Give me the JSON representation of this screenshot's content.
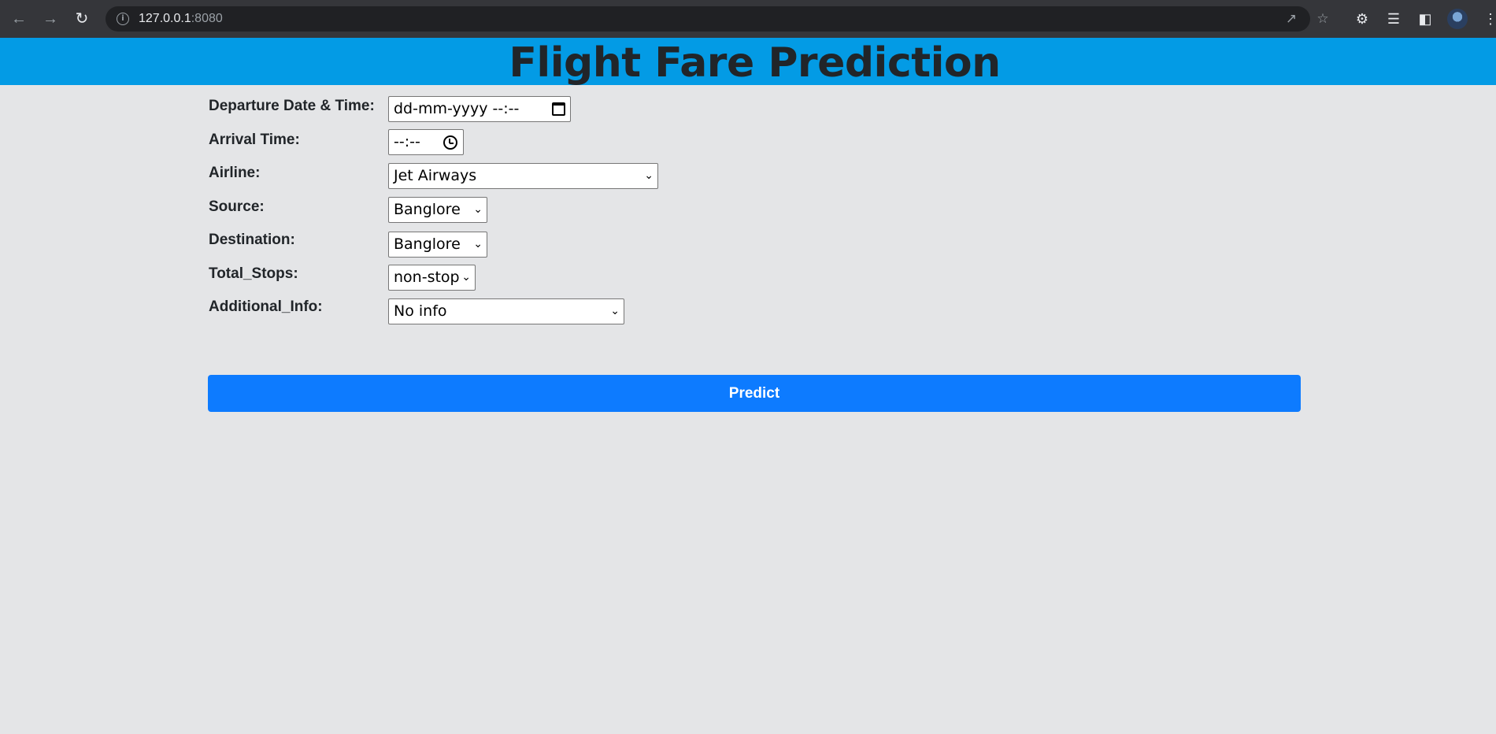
{
  "browser": {
    "url_host": "127.0.0.1",
    "url_port": ":8080"
  },
  "page": {
    "title": "Flight Fare Prediction"
  },
  "form": {
    "departure_label": "Departure Date & Time:",
    "departure_value": "dd-mm-yyyy --:--",
    "arrival_label": "Arrival Time:",
    "arrival_value": "--:--",
    "airline_label": "Airline:",
    "airline_value": "Jet Airways",
    "source_label": "Source:",
    "source_value": "Banglore",
    "destination_label": "Destination:",
    "destination_value": "Banglore",
    "stops_label": "Total_Stops:",
    "stops_value": "non-stop",
    "info_label": "Additional_Info:",
    "info_value": "No info",
    "predict_label": "Predict"
  },
  "colors": {
    "header_bg": "#039be5",
    "page_bg": "#e4e5e7",
    "button_bg": "#0d7bff"
  },
  "icons": [
    "back-arrow-icon",
    "forward-arrow-icon",
    "reload-icon",
    "info-icon",
    "share-icon",
    "star-icon",
    "extensions-icon",
    "media-icon",
    "sidepanel-icon",
    "calendar-icon",
    "clock-icon",
    "chevron-down-icon"
  ]
}
